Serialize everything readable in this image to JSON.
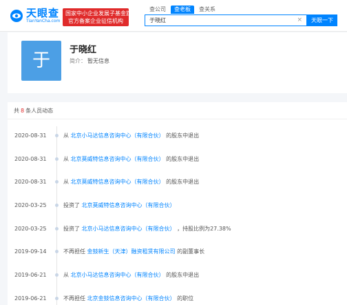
{
  "header": {
    "logo_text": "天眼查",
    "logo_subtext": "TianYanCha.com",
    "badge_line1": "国家中小企业发展子基金旗下",
    "badge_line2": "官方备案企业征信机构",
    "tabs": [
      {
        "label": "查公司",
        "active": false
      },
      {
        "label": "查老板",
        "active": true
      },
      {
        "label": "查关系",
        "active": false
      }
    ],
    "search_value": "于晓红",
    "clear_icon": "×",
    "search_button": "天眼一下"
  },
  "profile": {
    "avatar_char": "于",
    "name": "于晓红",
    "intro_label": "简介：",
    "intro_value": "暂无信息"
  },
  "activity": {
    "header_prefix": "共",
    "count": "8",
    "header_suffix": "条人员动态",
    "rows": [
      {
        "date": "2020-08-31",
        "pre": "从",
        "link": "北京小马达信息咨询中心（有限合伙）",
        "post": "的股东中退出"
      },
      {
        "date": "2020-08-31",
        "pre": "从",
        "link": "北京莫威特信息咨询中心（有限合伙）",
        "post": "的股东中退出"
      },
      {
        "date": "2020-08-31",
        "pre": "从",
        "link": "北京莫威特信息咨询中心（有限合伙）",
        "post": "的股东中退出"
      },
      {
        "date": "2020-03-25",
        "pre": "投资了",
        "link": "北京莫威特信息咨询中心（有限合伙）",
        "post": ""
      },
      {
        "date": "2020-03-25",
        "pre": "投资了",
        "link": "北京小马达信息咨询中心（有限合伙）",
        "post": "，持股比例为27.38%"
      },
      {
        "date": "2019-09-14",
        "pre": "不再担任",
        "link": "金鼓新生（天津）融资租赁有限公司",
        "post": "的副董事长"
      },
      {
        "date": "2019-06-21",
        "pre": "从",
        "link": "北京小马达信息咨询中心（有限合伙）",
        "post": "的股东中退出"
      },
      {
        "date": "2019-06-21",
        "pre": "不再担任",
        "link": "北京金鼓信息咨询中心（有限合伙）",
        "post": "的职位"
      }
    ]
  },
  "colors": {
    "brand_blue": "#0084ff",
    "badge_red": "#e02b2b",
    "avatar_bg": "#4c9fe5"
  }
}
